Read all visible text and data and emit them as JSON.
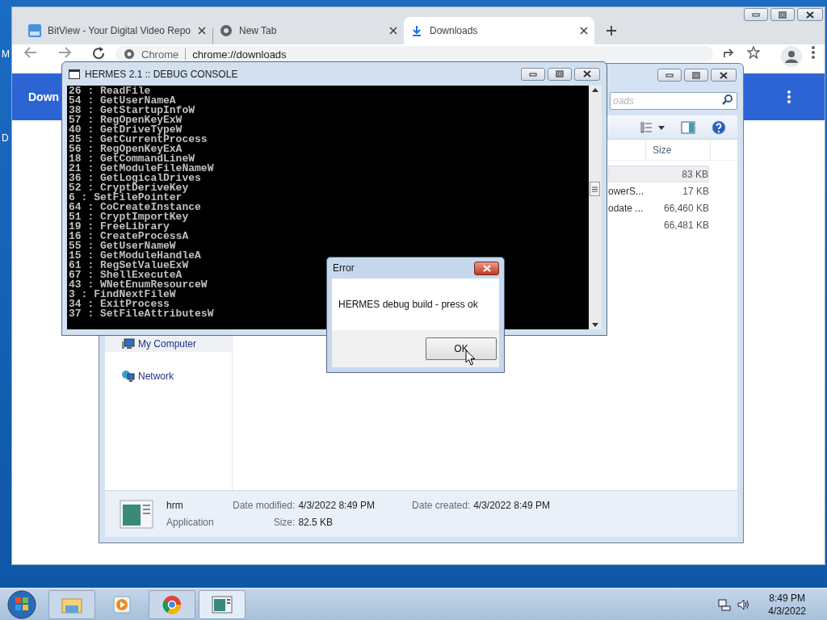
{
  "desktop": {
    "icon_labels": [
      "M",
      "D"
    ]
  },
  "browser": {
    "tabs": [
      {
        "title": "BitView - Your Digital Video Repo",
        "kind": "bitview",
        "selected": false
      },
      {
        "title": "New Tab",
        "kind": "chrome",
        "selected": false
      },
      {
        "title": "Downloads",
        "kind": "download",
        "selected": true
      }
    ],
    "omnibox": {
      "chip": "Chrome",
      "url": "chrome://downloads"
    },
    "page_title": "Down"
  },
  "explorer": {
    "search": {
      "placeholder": "oads"
    },
    "columns": [
      "Size"
    ],
    "files": [
      {
        "size": "83 KB",
        "selected": true
      },
      {
        "name": "owerS...",
        "size": "17 KB",
        "selected": false
      },
      {
        "name": "odate ...",
        "size": "66,460 KB",
        "selected": false
      },
      {
        "size": "66,481 KB",
        "selected": false
      }
    ],
    "nav": [
      {
        "label": "My Computer",
        "kind": "computer",
        "selected": true
      },
      {
        "label": "Network",
        "kind": "network",
        "selected": false
      }
    ],
    "details": {
      "name": "hrm",
      "type": "Application",
      "fields": [
        {
          "label": "Date modified:",
          "value": "4/3/2022 8:49 PM"
        },
        {
          "label": "Size:",
          "value": "82.5 KB"
        },
        {
          "label": "Date created:",
          "value": "4/3/2022 8:49 PM"
        }
      ]
    }
  },
  "console": {
    "title": "HERMES 2.1 :: DEBUG CONSOLE",
    "lines": [
      "26 : ReadFile",
      "54 : GetUserNameA",
      "38 : GetStartupInfoW",
      "57 : RegOpenKeyExW",
      "40 : GetDriveTypeW",
      "35 : GetCurrentProcess",
      "56 : RegOpenKeyExA",
      "18 : GetCommandLineW",
      "21 : GetModuleFileNameW",
      "36 : GetLogicalDrives",
      "52 : CryptDeriveKey",
      "6 : SetFilePointer",
      "64 : CoCreateInstance",
      "51 : CryptImportKey",
      "19 : FreeLibrary",
      "16 : CreateProcessA",
      "55 : GetUserNameW",
      "15 : GetModuleHandleA",
      "61 : RegSetValueExW",
      "67 : ShellExecuteA",
      "43 : WNetEnumResourceW",
      "3 : FindNextFileW",
      "34 : ExitProcess",
      "37 : SetFileAttributesW"
    ]
  },
  "dialog": {
    "title": "Error",
    "message": "HERMES debug build - press ok",
    "button": "OK"
  },
  "taskbar": {
    "apps": [
      {
        "kind": "folder",
        "running": true,
        "selected": false
      },
      {
        "kind": "media",
        "running": false,
        "selected": false
      },
      {
        "kind": "chrome",
        "running": true,
        "selected": false
      },
      {
        "kind": "app",
        "running": true,
        "selected": true
      }
    ],
    "clock": {
      "time": "8:49 PM",
      "date": "4/3/2022"
    }
  }
}
